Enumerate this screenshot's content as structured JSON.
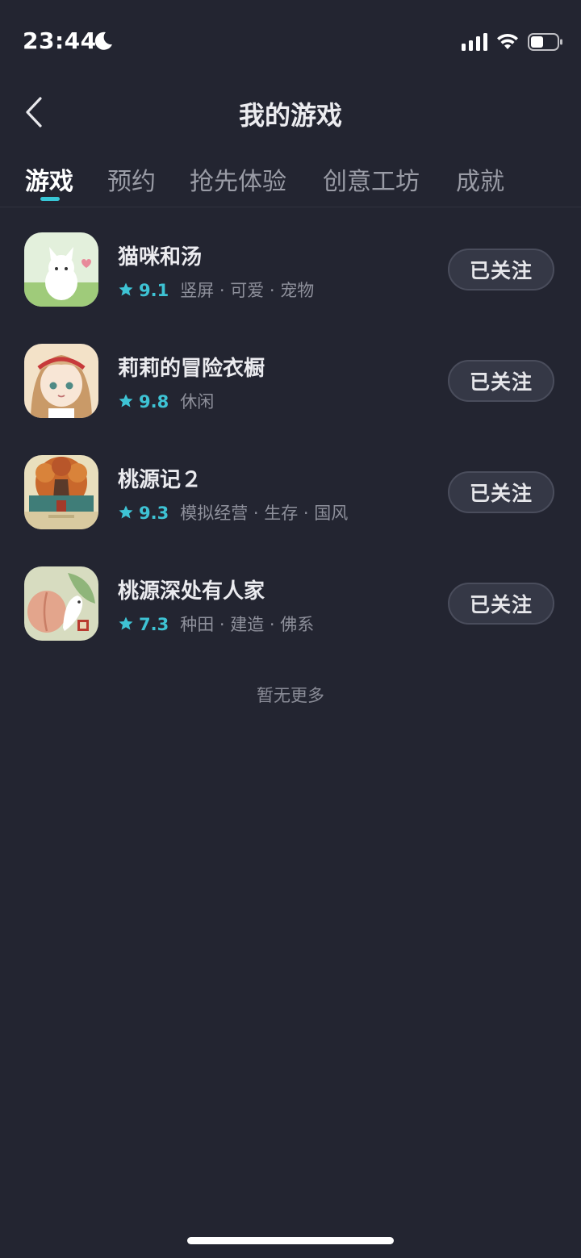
{
  "status_bar": {
    "time": "23:44",
    "icons": [
      "moon-icon",
      "signal-icon",
      "wifi-icon",
      "battery-icon"
    ]
  },
  "header": {
    "title": "我的游戏",
    "back_icon": "chevron-left-icon"
  },
  "tabs": [
    {
      "label": "游戏",
      "active": true
    },
    {
      "label": "预约",
      "active": false
    },
    {
      "label": "抢先体验",
      "active": false
    },
    {
      "label": "创意工坊",
      "active": false
    },
    {
      "label": "成就",
      "active": false
    }
  ],
  "games": [
    {
      "name": "猫咪和汤",
      "rating": "9.1",
      "tags": "竖屏 · 可爱 · 宠物",
      "button": "已关注",
      "icon": "cat-soup-icon"
    },
    {
      "name": "莉莉的冒险衣橱",
      "rating": "9.8",
      "tags": "休闲",
      "button": "已关注",
      "icon": "lily-wardrobe-icon"
    },
    {
      "name": "桃源记２",
      "rating": "9.3",
      "tags": "模拟经营 · 生存 · 国风",
      "button": "已关注",
      "icon": "taoyuanji-icon"
    },
    {
      "name": "桃源深处有人家",
      "rating": "7.3",
      "tags": "种田 · 建造 · 佛系",
      "button": "已关注",
      "icon": "peach-spring-icon"
    }
  ],
  "footer_text": "暂无更多",
  "colors": {
    "background": "#232531",
    "accent": "#3ec3d4",
    "button_bg": "#353846"
  }
}
